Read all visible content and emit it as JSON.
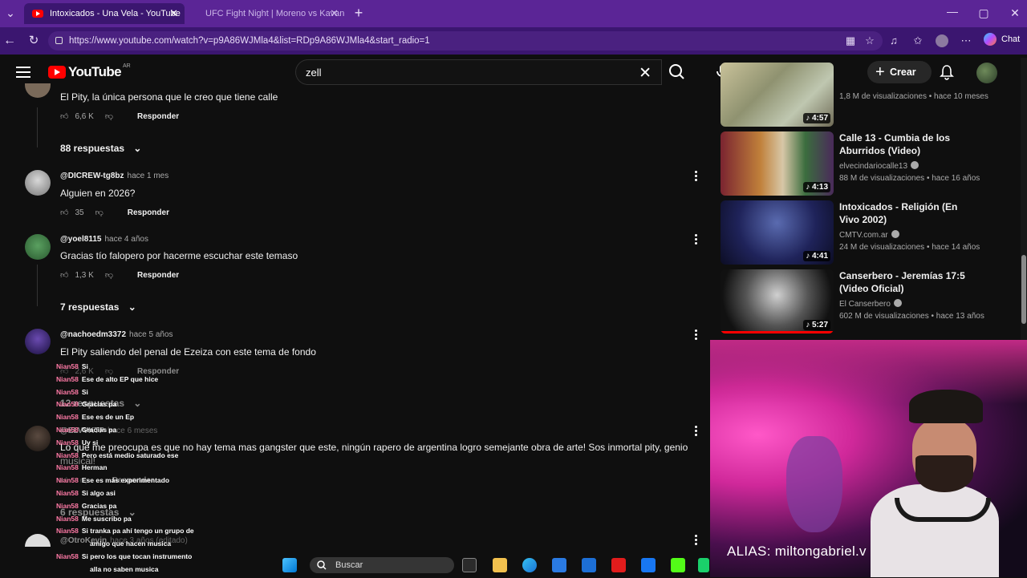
{
  "browser": {
    "tabs": [
      {
        "title": "Intoxicados - Una Vela - YouTube",
        "active": true
      },
      {
        "title": "UFC Fight Night | Moreno vs Kavan",
        "active": false
      }
    ],
    "url": "https://www.youtube.com/watch?v=p9A86WJMla4&list=RDp9A86WJMla4&start_radio=1",
    "chat_label": "Chat"
  },
  "youtube": {
    "logo_text": "YouTube",
    "country": "AR",
    "search_query": "zell",
    "create_label": "Crear"
  },
  "comments": [
    {
      "author": "",
      "time": "",
      "text": "El Pity, la única persona que le creo que tiene calle",
      "likes": "6,6 K",
      "reply": "Responder",
      "replies": "88 respuestas"
    },
    {
      "author": "@DICREW-tg8bz",
      "time": "hace 1 mes",
      "text": "Alguien en 2026?",
      "likes": "35",
      "reply": "Responder",
      "replies": ""
    },
    {
      "author": "@yoel8115",
      "time": "hace 4 años",
      "text": "Gracias tío falopero por hacerme escuchar este temaso",
      "likes": "1,3 K",
      "reply": "Responder",
      "replies": "7 respuestas"
    },
    {
      "author": "@nachoedm3372",
      "time": "hace 5 años",
      "text": "El Pity saliendo del penal de Ezeiza con este tema de fondo",
      "likes": "2,6 K",
      "reply": "Responder",
      "replies": "12 respuestas"
    },
    {
      "author": "@ELVVKTP",
      "time": "hace 6 meses",
      "text": "Lo que me preocupa es que no hay tema mas gangster que este, ningún rapero de argentina logro semejante obra de arte! Sos inmortal pity, genio",
      "text2": "musical!",
      "likes": "",
      "reply": "Responder",
      "replies": "6 respuestas"
    },
    {
      "author": "@OtroKevin",
      "time": "hace 3 años (editado)",
      "text": "",
      "likes": "",
      "reply": "",
      "replies": ""
    }
  ],
  "recommendations": [
    {
      "title": "",
      "channel": "",
      "meta": "1,8 M de visualizaciones • hace 10 meses",
      "duration": "4:57"
    },
    {
      "title": "Calle 13 - Cumbia de los Aburridos (Video)",
      "channel": "elvecindariocalle13",
      "meta": "88 M de visualizaciones • hace 16 años",
      "duration": "4:13"
    },
    {
      "title": "Intoxicados - Religión (En Vivo 2002)",
      "channel": "CMTV.com.ar",
      "meta": "24 M de visualizaciones • hace 14 años",
      "duration": "4:41"
    },
    {
      "title": "Canserbero - Jeremías 17:5 (Video Oficial)",
      "channel": "El Canserbero",
      "meta": "602 M de visualizaciones • hace 13 años",
      "duration": "5:27"
    }
  ],
  "chat_overlay": [
    {
      "nick": "Nian58",
      "msg": "Si"
    },
    {
      "nick": "Nian58",
      "msg": "Ese de alto EP que hice"
    },
    {
      "nick": "Nian58",
      "msg": "Si"
    },
    {
      "nick": "Nian58",
      "msg": "Gracias pa"
    },
    {
      "nick": "Nian58",
      "msg": "Ese es de un Ep"
    },
    {
      "nick": "Nian58",
      "msg": "Gracias pa"
    },
    {
      "nick": "Nian58",
      "msg": "Uy si"
    },
    {
      "nick": "Nian58",
      "msg": "Pero está medio saturado ese"
    },
    {
      "nick": "Nian58",
      "msg": "Herman"
    },
    {
      "nick": "Nian58",
      "msg": "Ese es más experimentado"
    },
    {
      "nick": "Nian58",
      "msg": "Si algo asi"
    },
    {
      "nick": "Nian58",
      "msg": "Gracias pa"
    },
    {
      "nick": "Nian58",
      "msg": "Me suscribo pa"
    },
    {
      "nick": "Nian58",
      "msg": "Si tranka pa ahí tengo un grupo de"
    },
    {
      "nick": "",
      "msg": "amigo que hacen musica"
    },
    {
      "nick": "Nian58",
      "msg": "Si pero los que tocan instrumento"
    },
    {
      "nick": "",
      "msg": "alla no saben musica"
    }
  ],
  "webcam": {
    "alias": "ALIAS: miltongabriel.v"
  },
  "taskbar": {
    "search_placeholder": "Buscar"
  }
}
